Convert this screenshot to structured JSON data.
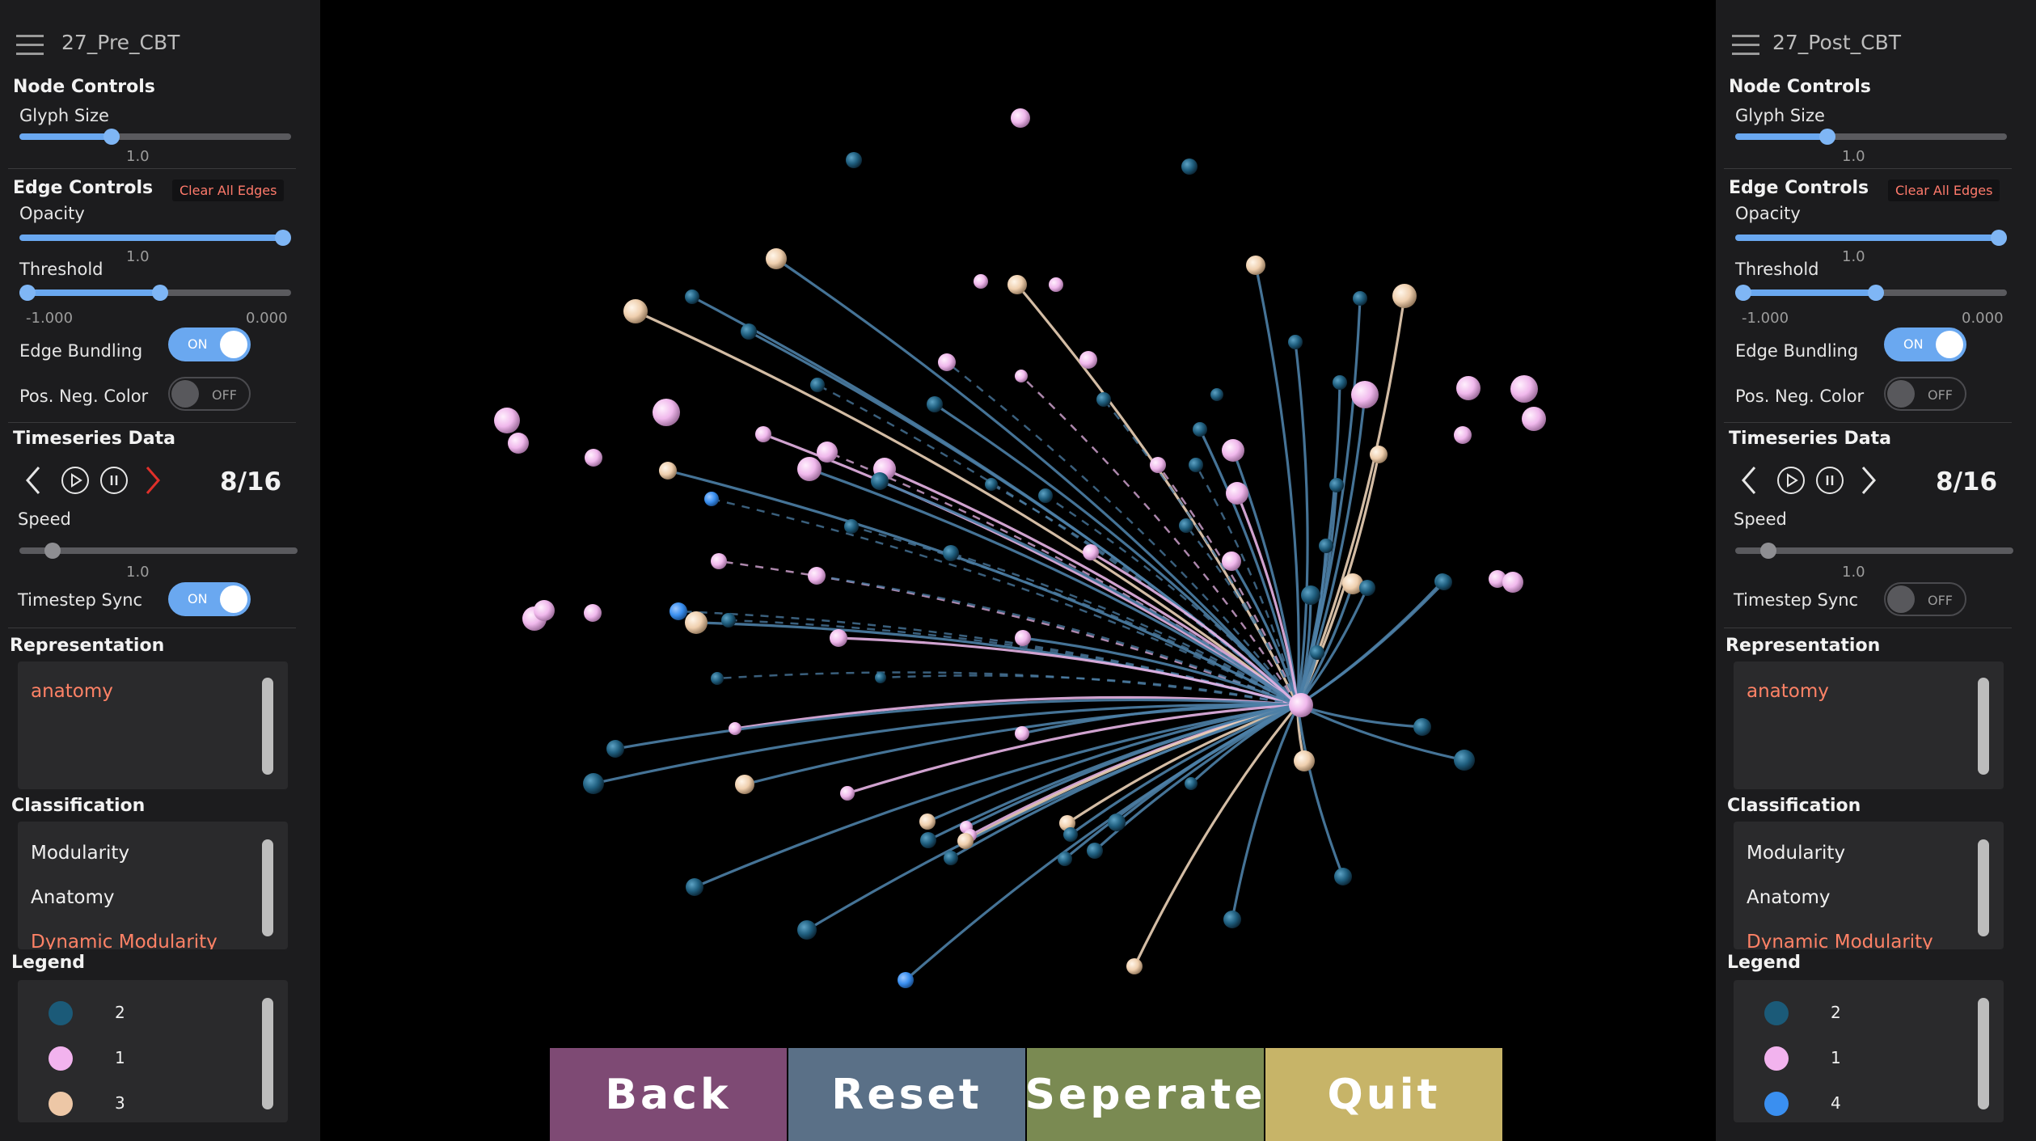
{
  "left_panel": {
    "title": "27_Pre_CBT",
    "node_controls": {
      "header": "Node Controls",
      "glyph_size_label": "Glyph Size",
      "glyph_size_value": "1.0",
      "glyph_size_level": 0.35
    },
    "edge_controls": {
      "header": "Edge Controls",
      "clear_label": "Clear All Edges",
      "opacity_label": "Opacity",
      "opacity_value": "1.0",
      "opacity_level": 1.0,
      "threshold_label": "Threshold",
      "threshold_min": "-1.000",
      "threshold_max": "0.000",
      "edge_bundling_label": "Edge Bundling",
      "edge_bundling_state": "ON",
      "pos_neg_label": "Pos. Neg. Color",
      "pos_neg_state": "OFF"
    },
    "timeseries": {
      "header": "Timeseries Data",
      "frame": "8/16",
      "speed_label": "Speed",
      "speed_value": "1.0",
      "sync_label": "Timestep Sync",
      "sync_state": "ON"
    },
    "representation": {
      "header": "Representation",
      "items": [
        "anatomy"
      ]
    },
    "classification": {
      "header": "Classification",
      "items": [
        "Modularity",
        "Anatomy",
        "Dynamic Modularity"
      ],
      "selected": "Dynamic Modularity"
    },
    "legend": {
      "header": "Legend",
      "items": [
        {
          "label": "2",
          "color": "#1b5a78"
        },
        {
          "label": "1",
          "color": "#f2b3ee"
        },
        {
          "label": "3",
          "color": "#edc7a6"
        }
      ]
    }
  },
  "right_panel": {
    "title": "27_Post_CBT",
    "node_controls": {
      "header": "Node Controls",
      "glyph_size_label": "Glyph Size",
      "glyph_size_value": "1.0",
      "glyph_size_level": 0.35
    },
    "edge_controls": {
      "header": "Edge Controls",
      "clear_label": "Clear All Edges",
      "opacity_label": "Opacity",
      "opacity_value": "1.0",
      "opacity_level": 1.0,
      "threshold_label": "Threshold",
      "threshold_min": "-1.000",
      "threshold_max": "0.000",
      "edge_bundling_label": "Edge Bundling",
      "edge_bundling_state": "ON",
      "pos_neg_label": "Pos. Neg. Color",
      "pos_neg_state": "OFF"
    },
    "timeseries": {
      "header": "Timeseries Data",
      "frame": "8/16",
      "speed_label": "Speed",
      "speed_value": "1.0",
      "sync_label": "Timestep Sync",
      "sync_state": "OFF"
    },
    "representation": {
      "header": "Representation",
      "items": [
        "anatomy"
      ]
    },
    "classification": {
      "header": "Classification",
      "items": [
        "Modularity",
        "Anatomy",
        "Dynamic Modularity"
      ],
      "selected": "Dynamic Modularity"
    },
    "legend": {
      "header": "Legend",
      "items": [
        {
          "label": "2",
          "color": "#1b5a78"
        },
        {
          "label": "1",
          "color": "#f2b3ee"
        },
        {
          "label": "4",
          "color": "#3a8ff0"
        }
      ]
    }
  },
  "bottom_buttons": {
    "back": {
      "label": "Back",
      "color": "#7e4a74"
    },
    "reset": {
      "label": "Reset",
      "color": "#5a7087"
    },
    "separate": {
      "label": "Seperate",
      "color": "#7a8a52"
    },
    "quit": {
      "label": "Quit",
      "color": "#c7b468"
    }
  },
  "colors": {
    "pink": "#f0b8ec",
    "teal": "#1f5e7e",
    "peach": "#efcfae",
    "blue": "#3a8ff0",
    "active_arrow": "#e0302a"
  }
}
